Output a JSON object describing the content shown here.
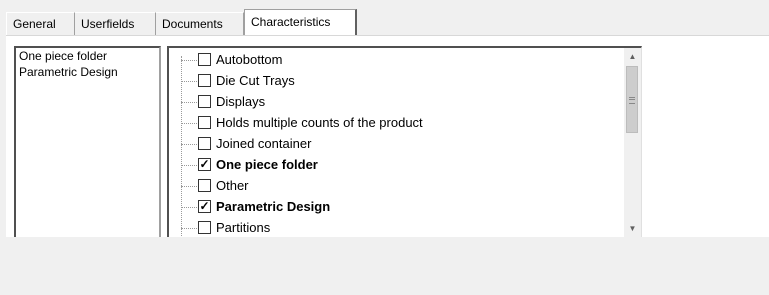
{
  "tabs": [
    {
      "label": "General"
    },
    {
      "label": "Userfields"
    },
    {
      "label": "Documents"
    },
    {
      "label": "Characteristics",
      "active": true
    }
  ],
  "selected_list": [
    "One piece folder",
    "Parametric Design"
  ],
  "characteristics": [
    {
      "label": "Autobottom",
      "checked": false
    },
    {
      "label": "Die Cut Trays",
      "checked": false
    },
    {
      "label": "Displays",
      "checked": false
    },
    {
      "label": "Holds multiple counts of the product",
      "checked": false
    },
    {
      "label": "Joined container",
      "checked": false
    },
    {
      "label": "One piece folder",
      "checked": true
    },
    {
      "label": "Other",
      "checked": false
    },
    {
      "label": "Parametric Design",
      "checked": true
    },
    {
      "label": "Partitions",
      "checked": false
    }
  ],
  "scrollbar": {
    "up_icon": "scroll-up-arrow-icon",
    "down_icon": "scroll-down-arrow-icon"
  }
}
